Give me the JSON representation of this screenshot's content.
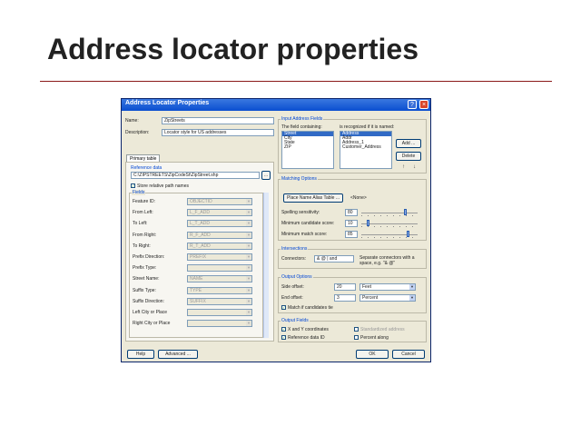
{
  "slide": {
    "title": "Address locator properties"
  },
  "dialog": {
    "title": "Address Locator Properties",
    "help_glyph": "?",
    "close_glyph": "×",
    "name_label": "Name:",
    "name_value": "ZipStreets",
    "description_label": "Description:",
    "description_value": "Locator style for US addresses",
    "tab_primary": "Primary table",
    "reference_data_label": "Reference data",
    "reference_data_value": "C:\\ZIPSTREETS\\ZipCodeSt\\ZipStreet.shp",
    "show_relative_label": "Store relative path names",
    "fields_group": "Fields",
    "field_rows": [
      {
        "label": "Feature ID:",
        "value": "OBJECTID"
      },
      {
        "label": "From Left:",
        "value": "L_F_ADD"
      },
      {
        "label": "To Left:",
        "value": "L_T_ADD"
      },
      {
        "label": "From Right:",
        "value": "R_F_ADD"
      },
      {
        "label": "To Right:",
        "value": "R_T_ADD"
      },
      {
        "label": "Prefix Direction:",
        "value": "PREFIX"
      },
      {
        "label": "Prefix Type:",
        "value": ""
      },
      {
        "label": "Street Name:",
        "value": "NAME"
      },
      {
        "label": "Suffix Type:",
        "value": "TYPE"
      },
      {
        "label": "Suffix Direction:",
        "value": "SUFFIX"
      },
      {
        "label": "Left City or Place",
        "value": ""
      },
      {
        "label": "Right City or Place",
        "value": ""
      }
    ],
    "input_group": "Input Address Fields",
    "field_containing_label": "The field containing:",
    "field_containing_items": [
      "Street",
      "City",
      "State",
      "ZIP"
    ],
    "recognized_label": "is recognized if it is named:",
    "recognized_items": [
      "Address",
      "Addr",
      "Address_1",
      "Customer_Address"
    ],
    "add_btn": "Add ...",
    "delete_btn": "Delete",
    "up_glyph": "↑",
    "down_glyph": "↓",
    "matching_group": "Matching Options",
    "place_name_btn": "Place Name Alias Table ...",
    "place_name_value": "<None>",
    "spelling_label": "Spelling sensitivity:",
    "spelling_value": "80",
    "min_candidate_label": "Minimum candidate score:",
    "min_candidate_value": "10",
    "min_match_label": "Minimum match score:",
    "min_match_value": "85",
    "intersections_group": "Intersections",
    "connectors_label": "Connectors:",
    "connectors_value": "& @ | and",
    "connectors_note": "Separate connectors with a space, e.g. \"& @\"",
    "output_group": "Output Options",
    "side_offset_label": "Side offset:",
    "side_offset_value": "20",
    "side_offset_unit": "Feet",
    "end_offset_label": "End offset:",
    "end_offset_value": "3",
    "end_offset_unit": "Percent",
    "match_unmatched_label": "Match if candidates tie",
    "output_fields_group": "Output Fields",
    "xy_label": "X and Y coordinates",
    "ref_data_id_label": "Reference data ID",
    "standardized_label": "Standardized address",
    "percent_along_label": "Percent along",
    "help_btn": "Help",
    "advanced_btn": "Advanced ...",
    "ok_btn": "OK",
    "cancel_btn": "Cancel",
    "checkbox_mark": "✓",
    "dropdown_glyph": "▼",
    "browse_glyph": "…",
    "checkbox_states": {
      "show_relative": true,
      "match_unmatched": true,
      "xy": true,
      "ref_data_id": true,
      "standardized": false,
      "percent_along": false
    },
    "slider_levels": {
      "spelling": 0.8,
      "min_candidate": 0.1,
      "min_match": 0.85
    }
  }
}
